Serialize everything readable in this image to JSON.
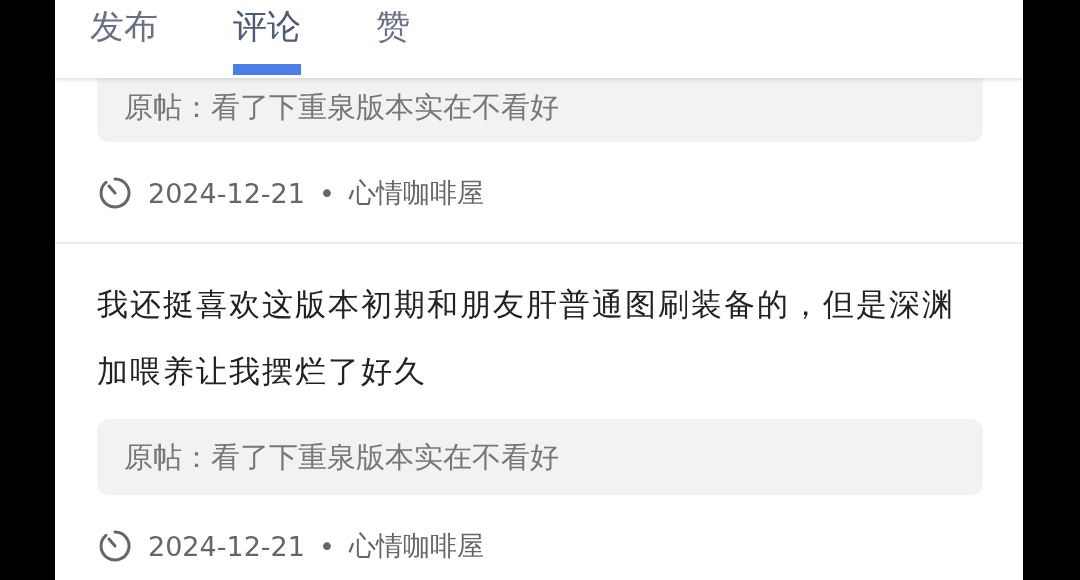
{
  "tabs": [
    {
      "label": "发布",
      "selected": false
    },
    {
      "label": "评论",
      "selected": true
    },
    {
      "label": "赞",
      "selected": false
    }
  ],
  "comments": [
    {
      "quote": "原帖：看了下重泉版本实在不看好",
      "date": "2024-12-21",
      "separator": "•",
      "board": "心情咖啡屋"
    },
    {
      "text": "我还挺喜欢这版本初期和朋友肝普通图刷装备的，但是深渊加喂养让我摆烂了好久",
      "quote": "原帖：看了下重泉版本实在不看好",
      "date": "2024-12-21",
      "separator": "•",
      "board": "心情咖啡屋"
    }
  ]
}
